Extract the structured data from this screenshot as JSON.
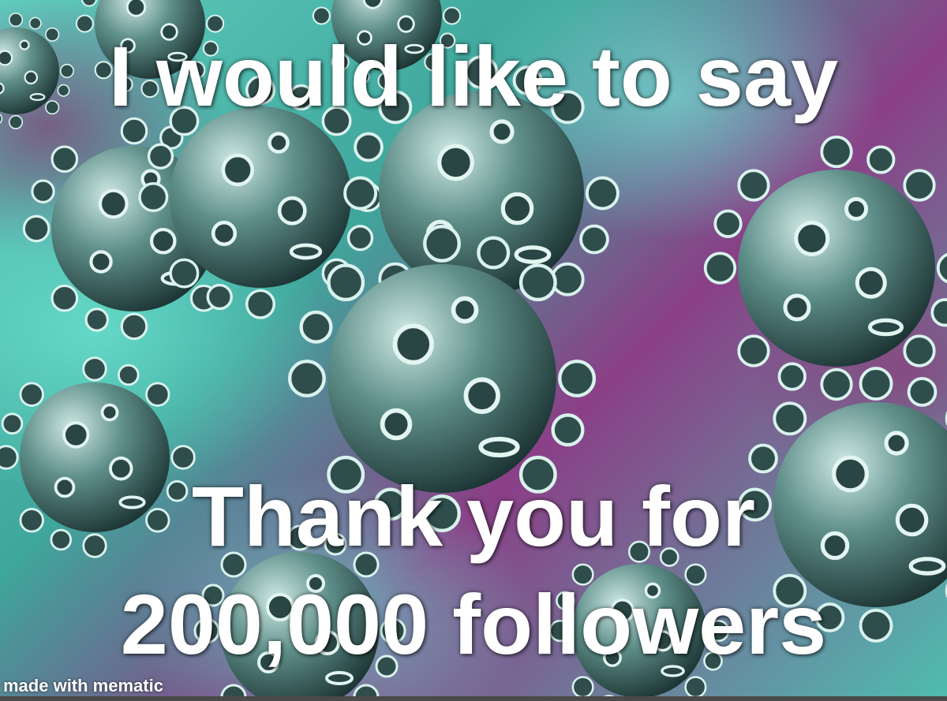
{
  "meme": {
    "top_text": "I would like to say",
    "bottom_line1": "Thank you for",
    "bottom_line2": "200,000 followers",
    "watermark": "made with mematic"
  },
  "colors": {
    "text": "#ffffff",
    "virus_body": "#2f4d4b",
    "virus_highlight": "#cfe9e4",
    "background_teal": "#5fcfbf",
    "background_magenta": "#8a3f86"
  }
}
